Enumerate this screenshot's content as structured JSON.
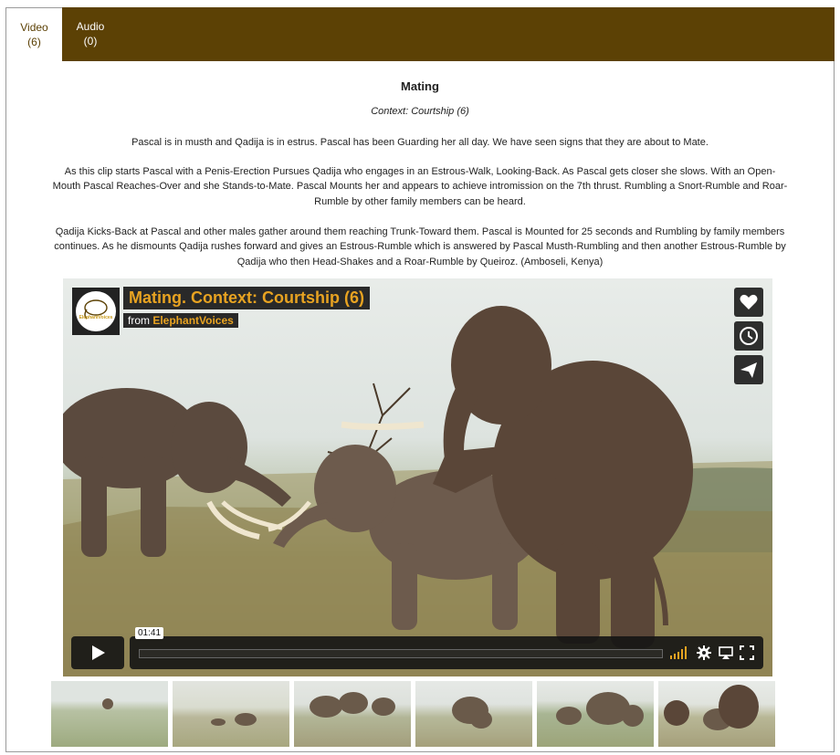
{
  "tabs": [
    {
      "label": "Video",
      "count": "(6)"
    },
    {
      "label": "Audio",
      "count": "(0)"
    }
  ],
  "content": {
    "title": "Mating",
    "context": "Context: Courtship (6)",
    "paragraphs": [
      "Pascal is in musth and Qadija is in estrus. Pascal has been Guarding her all day. We have seen signs that they are about to Mate.",
      "As this clip starts Pascal with a Penis-Erection Pursues Qadija who engages in an Estrous-Walk, Looking-Back. As Pascal gets closer she slows. With an Open-Mouth Pascal Reaches-Over and she Stands-to-Mate. Pascal Mounts her and appears to achieve intromission on the 7th thrust. Rumbling a Snort-Rumble and Roar-Rumble by other family members can be heard.",
      "Qadija Kicks-Back at Pascal and other males gather around them reaching Trunk-Toward them. Pascal is Mounted for 25 seconds and Rumbling by family members continues. As he dismounts Qadija rushes forward and gives an Estrous-Rumble which is answered by Pascal Musth-Rumbling and then another Estrous-Rumble by Qadija who then Head-Shakes and a Roar-Rumble by Queiroz. (Amboseli, Kenya)"
    ]
  },
  "video": {
    "title": "Mating. Context: Courtship (6)",
    "from_label": "from",
    "channel": "ElephantVoices",
    "logo_text": "ElephantVoices",
    "time": "01:41",
    "progress": 0,
    "side_buttons": [
      "heart-icon",
      "clock-icon",
      "send-icon"
    ],
    "control_icons": [
      "play-icon",
      "volume-icon",
      "settings-icon",
      "airplay-icon",
      "fullscreen-icon"
    ]
  },
  "thumbnails": 6,
  "colors": {
    "tab_bar": "#5c4105",
    "accent": "#e8a321"
  }
}
